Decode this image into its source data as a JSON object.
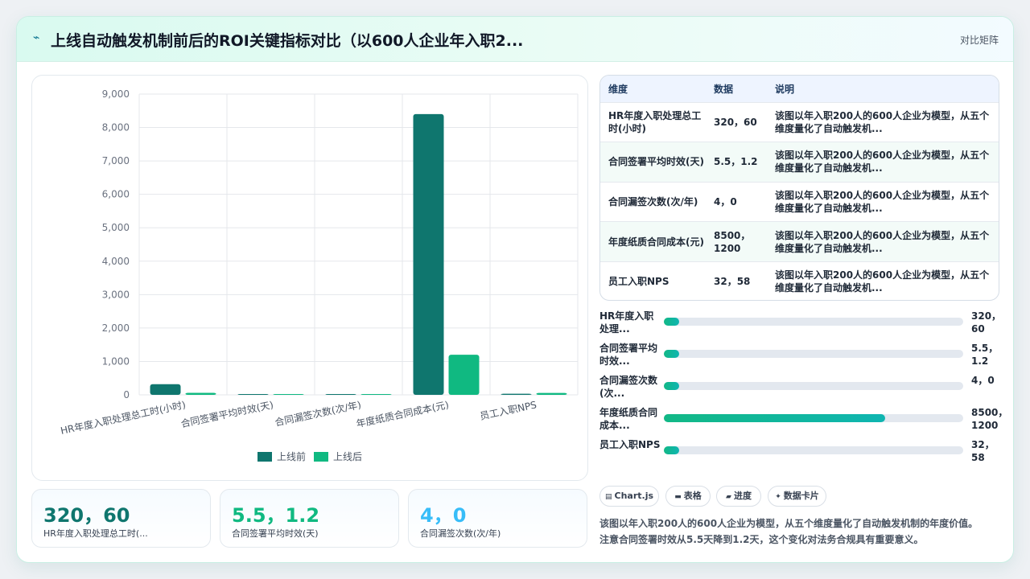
{
  "header": {
    "title": "上线自动触发机制前后的ROI关键指标对比（以600人企业年入职2...",
    "tag": "对比矩阵",
    "bolt_icon": "⌁"
  },
  "chart_data": {
    "type": "bar",
    "categories": [
      "HR年度入职处理总工时(小时)",
      "合同签署平均时效(天)",
      "合同漏签次数(次/年)",
      "年度纸质合同成本(元)",
      "员工入职NPS"
    ],
    "series": [
      {
        "name": "上线前",
        "values": [
          320,
          5.5,
          4,
          8400,
          32
        ],
        "color": "#0f766e"
      },
      {
        "name": "上线后",
        "values": [
          60,
          1.2,
          0,
          1200,
          58
        ],
        "color": "#10b981"
      }
    ],
    "yticks": [
      "0",
      "1,000",
      "2,000",
      "3,000",
      "4,000",
      "5,000",
      "6,000",
      "7,000",
      "8,000",
      "9,000"
    ],
    "ylim": [
      0,
      9000
    ],
    "legend_position": "bottom",
    "grid": true
  },
  "kpis": [
    {
      "value": "320，60",
      "label": "HR年度入职处理总工时(...",
      "color": "#0f766e"
    },
    {
      "value": "5.5，1.2",
      "label": "合同签署平均时效(天)",
      "color": "#10b981"
    },
    {
      "value": "4，0",
      "label": "合同漏签次数(次/年)",
      "color": "#38bdf8"
    }
  ],
  "table": {
    "headers": [
      "维度",
      "数据",
      "说明"
    ],
    "rows": [
      {
        "dim": "HR年度入职处理总工时(小时)",
        "num": "320，60",
        "desc": "该图以年入职200人的600人企业为模型，从五个维度量化了自动触发机..."
      },
      {
        "dim": "合同签署平均时效(天)",
        "num": "5.5，1.2",
        "desc": "该图以年入职200人的600人企业为模型，从五个维度量化了自动触发机..."
      },
      {
        "dim": "合同漏签次数(次/年)",
        "num": "4，0",
        "desc": "该图以年入职200人的600人企业为模型，从五个维度量化了自动触发机..."
      },
      {
        "dim": "年度纸质合同成本(元)",
        "num": "8500，1200",
        "desc": "该图以年入职200人的600人企业为模型，从五个维度量化了自动触发机..."
      },
      {
        "dim": "员工入职NPS",
        "num": "32，58",
        "desc": "该图以年入职200人的600人企业为模型，从五个维度量化了自动触发机..."
      }
    ]
  },
  "progress": [
    {
      "label": "HR年度入职处理...",
      "value": "320，60",
      "fraction": 0.05
    },
    {
      "label": "合同签署平均时效...",
      "value": "5.5，1.2",
      "fraction": 0.05
    },
    {
      "label": "合同漏签次数(次...",
      "value": "4，0",
      "fraction": 0.05
    },
    {
      "label": "年度纸质合同成本...",
      "value": "8500，1200",
      "fraction": 0.74
    },
    {
      "label": "员工入职NPS",
      "value": "32，58",
      "fraction": 0.05
    }
  ],
  "pills": [
    {
      "icon": "▤",
      "label": "Chart.js"
    },
    {
      "icon": "▬",
      "label": "表格"
    },
    {
      "icon": "▰",
      "label": "进度"
    },
    {
      "icon": "✦",
      "label": "数据卡片"
    }
  ],
  "note": "该图以年入职200人的600人企业为模型，从五个维度量化了自动触发机制的年度价值。注意合同签署时效从5.5天降到1.2天，这个变化对法务合规具有重要意义。"
}
